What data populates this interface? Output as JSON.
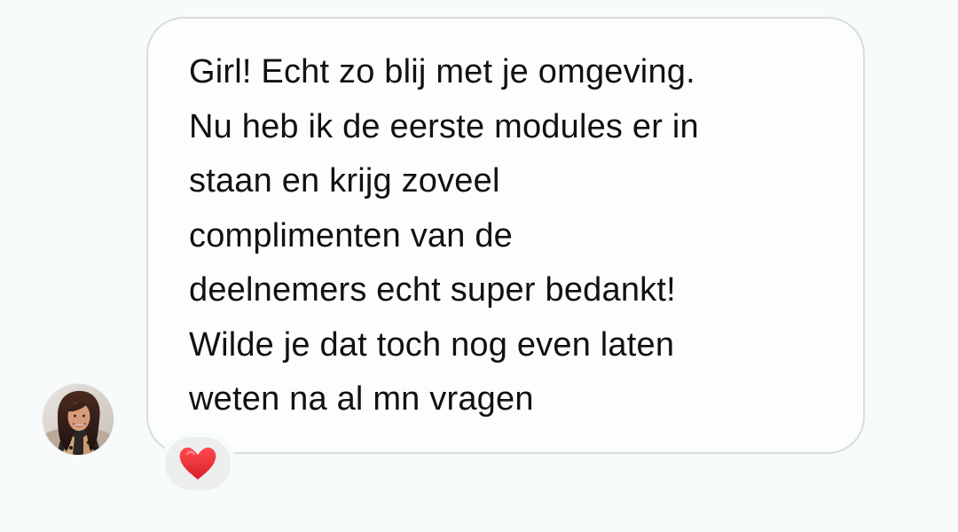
{
  "message": {
    "lines": [
      "Girl! Echt zo blij met je omgeving.",
      "Nu heb ik de eerste modules er in",
      "staan en krijg zoveel",
      "complimenten van de",
      "deelnemers echt super bedankt!",
      "Wilde je dat toch nog even laten",
      "weten na al mn vragen"
    ]
  },
  "sender": {
    "avatar_icon": "profile-photo"
  },
  "reaction": {
    "icon": "red-heart-icon",
    "color": "#e3262f"
  },
  "colors": {
    "background": "#f8fbfc",
    "bubble_border": "#d9dbdd",
    "text": "#111111",
    "reaction_background": "#edeeee"
  }
}
